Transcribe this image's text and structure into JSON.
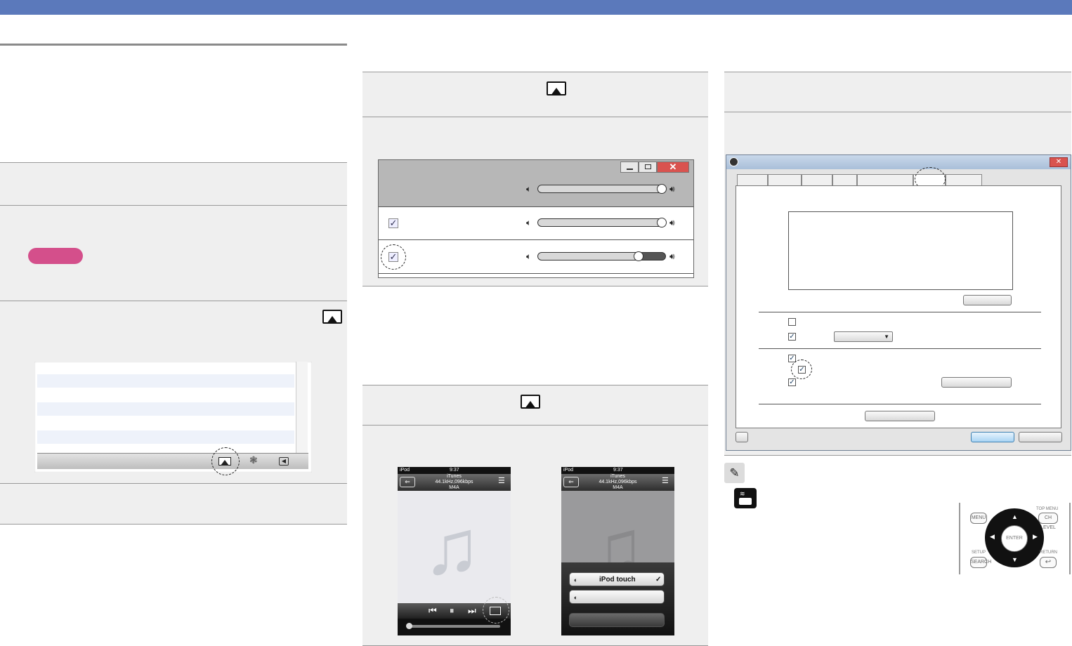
{
  "phone_left": {
    "status_carrier": "iPod",
    "status_time": "9:37",
    "head_line1": "iTunes",
    "head_line2": "44.1kHz,096kbps",
    "head_line3": "M4A"
  },
  "phone_right": {
    "status_carrier": "iPod",
    "status_time": "9:37",
    "head_line1": "iTunes",
    "head_line2": "44.1kHz,096kbps",
    "head_line3": "M4A",
    "menu_selected": "iPod touch"
  },
  "remote": {
    "menu": "MENU",
    "top_menu": "TOP MENU",
    "ch_level": "CH LEVEL",
    "enter": "ENTER",
    "setup": "SETUP",
    "search": "SEARCH",
    "return": "RETURN"
  },
  "colors": {
    "topbar": "#5b79bb",
    "pill": "#d44f8b",
    "step_bg": "#efefef"
  },
  "speakers": {
    "master_volume": 0.96,
    "row1_volume": 0.96,
    "row2_volume": 0.78
  },
  "icons": [
    "airplay-icon",
    "speaker-low-icon",
    "speaker-high-icon",
    "checkbox-icon",
    "pencil-icon",
    "remote-icon",
    "music-note-icon"
  ]
}
